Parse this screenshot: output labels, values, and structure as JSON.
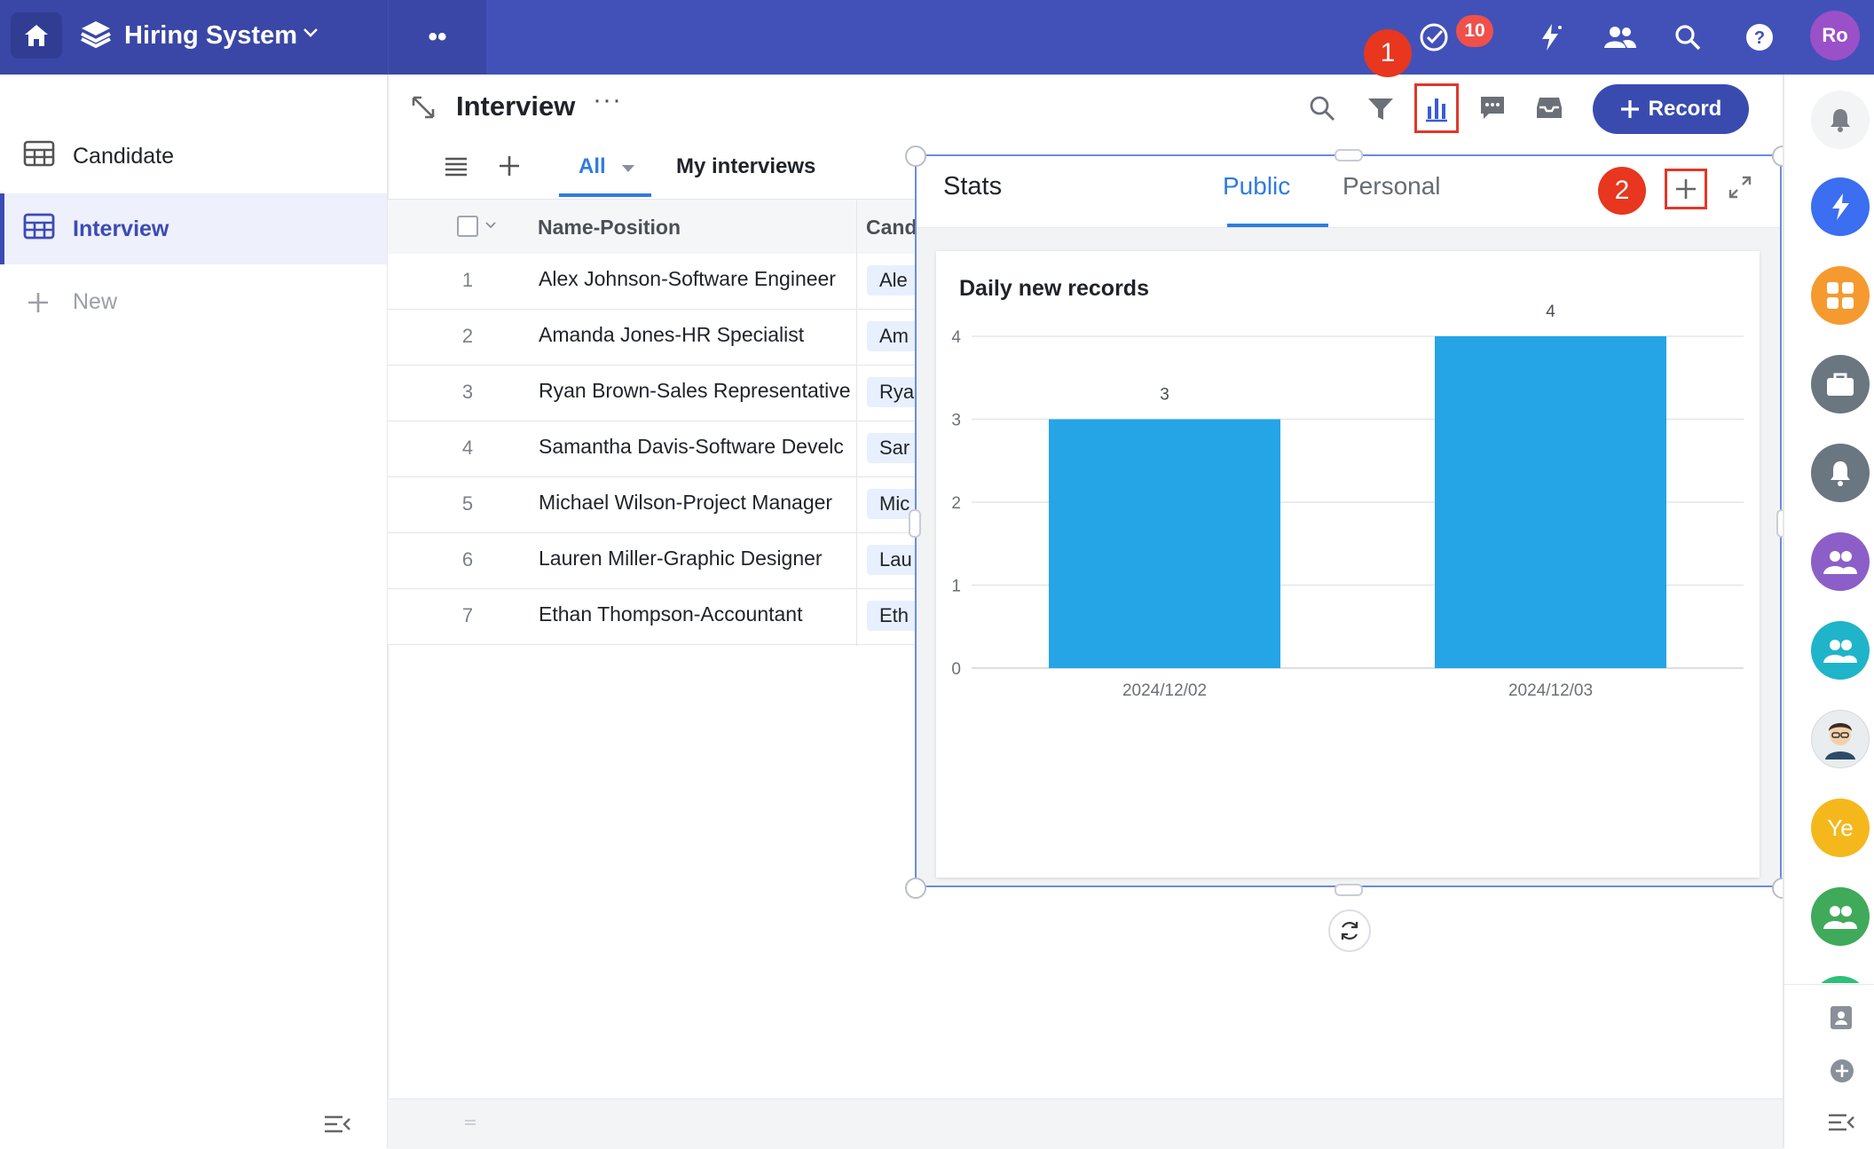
{
  "app": {
    "title": "Hiring System",
    "avatar": "Ro",
    "notifications_count": "10"
  },
  "callouts": {
    "first": "1",
    "second": "2"
  },
  "sidebar": {
    "items": [
      {
        "label": "Candidate"
      },
      {
        "label": "Interview"
      }
    ],
    "new_label": "New"
  },
  "view": {
    "title": "Interview",
    "more": "···",
    "record_button": "Record",
    "tabs": [
      {
        "label": "All"
      },
      {
        "label": "My interviews"
      }
    ]
  },
  "table": {
    "columns": [
      "Name-Position",
      "Cand"
    ],
    "rows": [
      {
        "num": "1",
        "name": "Alex Johnson-Software Engineer",
        "candidate": "Ale"
      },
      {
        "num": "2",
        "name": "Amanda Jones-HR Specialist",
        "candidate": "Am"
      },
      {
        "num": "3",
        "name": "Ryan Brown-Sales Representative",
        "candidate": "Rya"
      },
      {
        "num": "4",
        "name": "Samantha Davis-Software Develc",
        "candidate": "Sar"
      },
      {
        "num": "5",
        "name": "Michael Wilson-Project Manager",
        "candidate": "Mic"
      },
      {
        "num": "6",
        "name": "Lauren Miller-Graphic Designer",
        "candidate": "Lau"
      },
      {
        "num": "7",
        "name": "Ethan Thompson-Accountant",
        "candidate": "Eth"
      }
    ]
  },
  "stats": {
    "title": "Stats",
    "tabs": {
      "public": "Public",
      "personal": "Personal"
    },
    "active_tab": "Public"
  },
  "rail": {
    "ye_label": "Ye"
  },
  "colors": {
    "accent": "#3a4bb0",
    "topbar": "#4251b8",
    "bar": "#25a4e6",
    "tab_active": "#2f7be3",
    "callout": "#e8361f"
  },
  "chart_data": {
    "type": "bar",
    "title": "Daily new records",
    "categories": [
      "2024/12/02",
      "2024/12/03"
    ],
    "values": [
      3,
      4
    ],
    "ylim": [
      0,
      4
    ],
    "yticks": [
      0,
      1,
      2,
      3,
      4
    ],
    "grid": true,
    "data_labels": true
  }
}
